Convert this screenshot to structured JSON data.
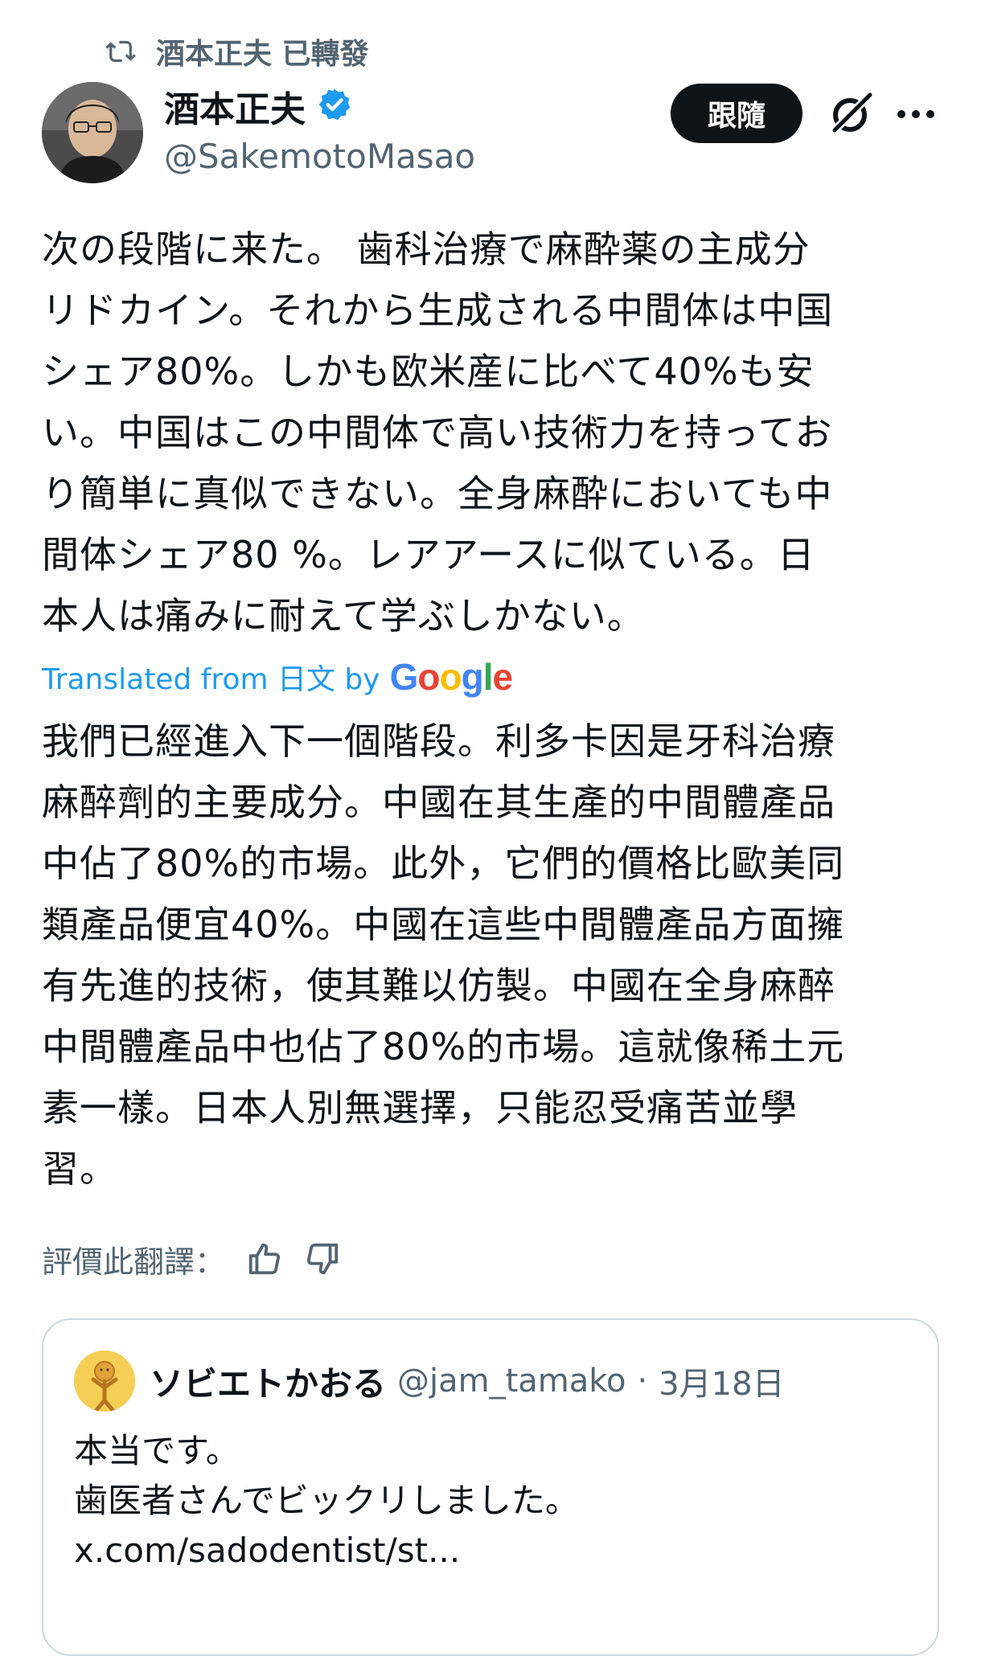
{
  "retweet": {
    "label": "酒本正夫 已轉發",
    "icon": "retweet-icon"
  },
  "author": {
    "name": "酒本正夫",
    "handle": "@SakemotoMasao",
    "verified": true,
    "verified_color": "#1d9bf0"
  },
  "actions": {
    "follow_label": "跟隨",
    "grok_icon": "grok-icon",
    "more_icon": "more-icon"
  },
  "tweet": {
    "text": "次の段階に来た。 歯科治療で麻酔薬の主成分\nリドカイン。それから生成される中間体は中国\nシェア80%。しかも欧米産に比べて40%も安\nい。中国はこの中間体で高い技術力を持ってお\nり簡単に真似できない。全身麻酔においても中\n間体シェア80 %。レアアースに似ている。日\n本人は痛みに耐えて学ぶしかない。"
  },
  "translation": {
    "prefix": "Translated from 日文 by",
    "provider": "Google",
    "text": "我們已經進入下一個階段。利多卡因是牙科治療\n麻醉劑的主要成分。中國在其生產的中間體產品\n中佔了80%的市場。此外，它們的價格比歐美同\n類產品便宜40%。中國在這些中間體產品方面擁\n有先進的技術，使其難以仿製。中國在全身麻醉\n中間體產品中也佔了80%的市場。這就像稀土元\n素一樣。日本人別無選擇，只能忍受痛苦並學\n習。",
    "rate_label": "評價此翻譯：",
    "like_icon": "thumbs-up-icon",
    "dislike_icon": "thumbs-down-icon"
  },
  "quote": {
    "name": "ソビエトかおる",
    "handle": "@jam_tamako",
    "separator": "·",
    "date": "3月18日",
    "text": "本当です。\n歯医者さんでビックリしました。\nx.com/sadodentist/st..."
  },
  "colors": {
    "accent": "#1d9bf0",
    "text": "#0f1419",
    "secondary": "#536471",
    "border": "#cfd9de",
    "follow_bg": "#0f1419"
  }
}
